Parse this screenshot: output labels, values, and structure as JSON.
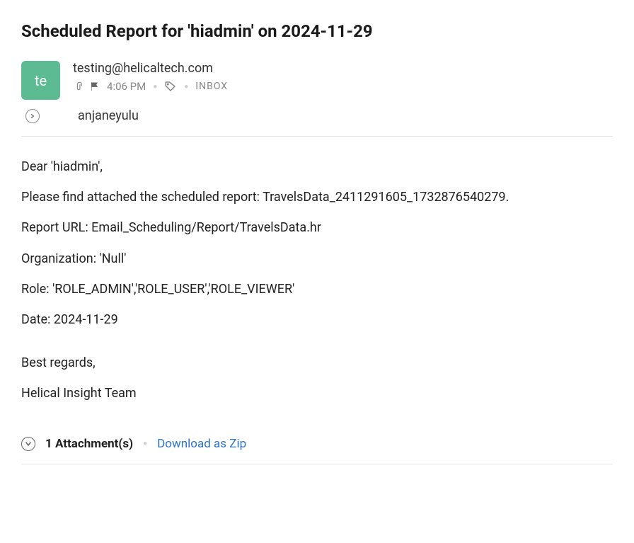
{
  "subject": "Scheduled Report for 'hiadmin' on 2024-11-29",
  "avatar_initials": "te",
  "from": "testing@helicaltech.com",
  "time": "4:06 PM",
  "folder": "INBOX",
  "to": "anjaneyulu",
  "body": {
    "greeting": "Dear 'hiadmin',",
    "line1": "Please find attached the scheduled report: TravelsData_2411291605_1732876540279.",
    "report_url": "Report URL: Email_Scheduling/Report/TravelsData.hr",
    "organization": "Organization: 'Null'",
    "role": "Role: 'ROLE_ADMIN','ROLE_USER','ROLE_VIEWER'",
    "date": "Date: 2024-11-29",
    "signoff": "Best regards,",
    "signature": "Helical Insight Team"
  },
  "attachments": {
    "count_label": "1 Attachment(s)",
    "download_label": "Download as Zip"
  }
}
